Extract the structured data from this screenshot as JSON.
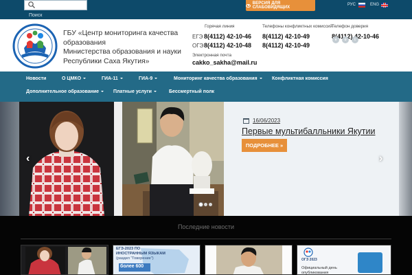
{
  "topbar": {
    "search_label": "Поиск",
    "vision_button": "ВЕРСИЯ ДЛЯ СЛАБОВИДЯЩИХ",
    "lang_ru": "РУС",
    "lang_en": "ENG"
  },
  "header": {
    "org_name_1": "ГБУ «Центр мониторинга качества",
    "org_name_2": "образования",
    "org_name_3": "Министерства образования и науки",
    "org_name_4": "Республики Саха Якутия»",
    "hotline_label": "Горячая линия",
    "conflict_label": "Телефоны конфликтных комиссий",
    "trust_label": "Телефон доверия",
    "hotline": [
      {
        "prefix": "ЕГЭ",
        "number": "8(4112) 42-10-46"
      },
      {
        "prefix": "ОГЭ",
        "number": "8(4112) 42-10-48"
      }
    ],
    "conflict": [
      "8(4112) 42-10-49",
      "8(4112) 42-10-49"
    ],
    "trust": "8(4112) 42-10-46",
    "email_label": "Электронная почта",
    "email": "cakko_sakha@mail.ru"
  },
  "nav": {
    "row1": [
      {
        "label": "Новости",
        "dropdown": false
      },
      {
        "label": "О ЦМКО",
        "dropdown": true
      },
      {
        "label": "ГИА-11",
        "dropdown": true
      },
      {
        "label": "ГИА-9",
        "dropdown": true
      },
      {
        "label": "Мониторинг качества образования",
        "dropdown": true
      },
      {
        "label": "Конфликтная комиссия",
        "dropdown": false
      }
    ],
    "row2": [
      {
        "label": "Дополнительное образование",
        "dropdown": true
      },
      {
        "label": "Платные услуги",
        "dropdown": true
      },
      {
        "label": "Бессмертный полк",
        "dropdown": false
      }
    ]
  },
  "slider": {
    "date": "16/06/2023",
    "title": "Первые мультибалльники Якутии",
    "more_button": "ПОДРОБНЕЕ »",
    "active_dot": 1,
    "dot_count": 3
  },
  "news": {
    "heading": "Последние новости",
    "card2_line1": "ЕГЭ-2023 ПО",
    "card2_line2": "ИНОСТРАННЫМ ЯЗЫКАМ",
    "card2_line3": "(раздел \"Говорение\")",
    "card2_big": "более 600",
    "card4_logo": "ОГЭ 2023",
    "card4_text": "Официальный день опубликования"
  },
  "colors": {
    "topbar": "#0d4a6a",
    "nav": "#236a87",
    "accent_orange": "#e7903a"
  }
}
